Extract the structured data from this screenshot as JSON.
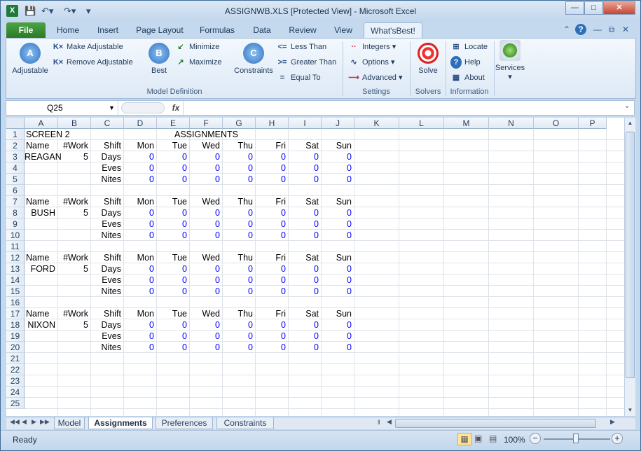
{
  "window": {
    "title": "ASSIGNWB.XLS  [Protected View]  -  Microsoft Excel",
    "app_icon": "X"
  },
  "qat": {
    "save_icon": "save-icon",
    "undo_icon": "undo-icon",
    "redo_icon": "redo-icon"
  },
  "tabs": [
    "File",
    "Home",
    "Insert",
    "Page Layout",
    "Formulas",
    "Data",
    "Review",
    "View",
    "What'sBest!"
  ],
  "ribbon": {
    "adjustable": "Adjustable",
    "make_adjustable": "Make Adjustable",
    "remove_adjustable": "Remove Adjustable",
    "best": "Best",
    "minimize": "Minimize",
    "maximize": "Maximize",
    "constraints": "Constraints",
    "less_than": "Less Than",
    "greater_than": "Greater Than",
    "equal_to": "Equal To",
    "integers": "Integers",
    "options": "Options",
    "advanced": "Advanced",
    "solve": "Solve",
    "locate": "Locate",
    "help": "Help",
    "about": "About",
    "services": "Services",
    "groups": {
      "model_definition": "Model Definition",
      "settings": "Settings",
      "solvers": "Solvers",
      "information": "Information"
    }
  },
  "formula_bar": {
    "name_box": "Q25",
    "fx": "fx",
    "formula": ""
  },
  "columns": [
    "A",
    "B",
    "C",
    "D",
    "E",
    "F",
    "G",
    "H",
    "I",
    "J",
    "K",
    "L",
    "M",
    "N",
    "O",
    "P"
  ],
  "rows": [
    "1",
    "2",
    "3",
    "4",
    "5",
    "6",
    "7",
    "8",
    "9",
    "10",
    "11",
    "12",
    "13",
    "14",
    "15",
    "16",
    "17",
    "18",
    "19",
    "20",
    "21",
    "22",
    "23",
    "24",
    "25"
  ],
  "sheet": {
    "a1": "SCREEN 2",
    "f1": "ASSIGNMENTS",
    "header": {
      "name": "Name",
      "work": "#Work",
      "shift": "Shift",
      "days": [
        "Mon",
        "Tue",
        "Wed",
        "Thu",
        "Fri",
        "Sat",
        "Sun"
      ]
    },
    "shifts": [
      "Days",
      "Eves",
      "Nites"
    ],
    "blocks": [
      {
        "name": "REAGAN",
        "work": "5",
        "values": [
          [
            "0",
            "0",
            "0",
            "0",
            "0",
            "0",
            "0"
          ],
          [
            "0",
            "0",
            "0",
            "0",
            "0",
            "0",
            "0"
          ],
          [
            "0",
            "0",
            "0",
            "0",
            "0",
            "0",
            "0"
          ]
        ]
      },
      {
        "name": "BUSH",
        "work": "5",
        "values": [
          [
            "0",
            "0",
            "0",
            "0",
            "0",
            "0",
            "0"
          ],
          [
            "0",
            "0",
            "0",
            "0",
            "0",
            "0",
            "0"
          ],
          [
            "0",
            "0",
            "0",
            "0",
            "0",
            "0",
            "0"
          ]
        ]
      },
      {
        "name": "FORD",
        "work": "5",
        "values": [
          [
            "0",
            "0",
            "0",
            "0",
            "0",
            "0",
            "0"
          ],
          [
            "0",
            "0",
            "0",
            "0",
            "0",
            "0",
            "0"
          ],
          [
            "0",
            "0",
            "0",
            "0",
            "0",
            "0",
            "0"
          ]
        ]
      },
      {
        "name": "NIXON",
        "work": "5",
        "values": [
          [
            "0",
            "0",
            "0",
            "0",
            "0",
            "0",
            "0"
          ],
          [
            "0",
            "0",
            "0",
            "0",
            "0",
            "0",
            "0"
          ],
          [
            "0",
            "0",
            "0",
            "0",
            "0",
            "0",
            "0"
          ]
        ]
      }
    ]
  },
  "sheet_tabs": [
    "Model",
    "Assignments",
    "Preferences",
    "Constraints"
  ],
  "status": {
    "ready": "Ready",
    "zoom": "100%"
  }
}
